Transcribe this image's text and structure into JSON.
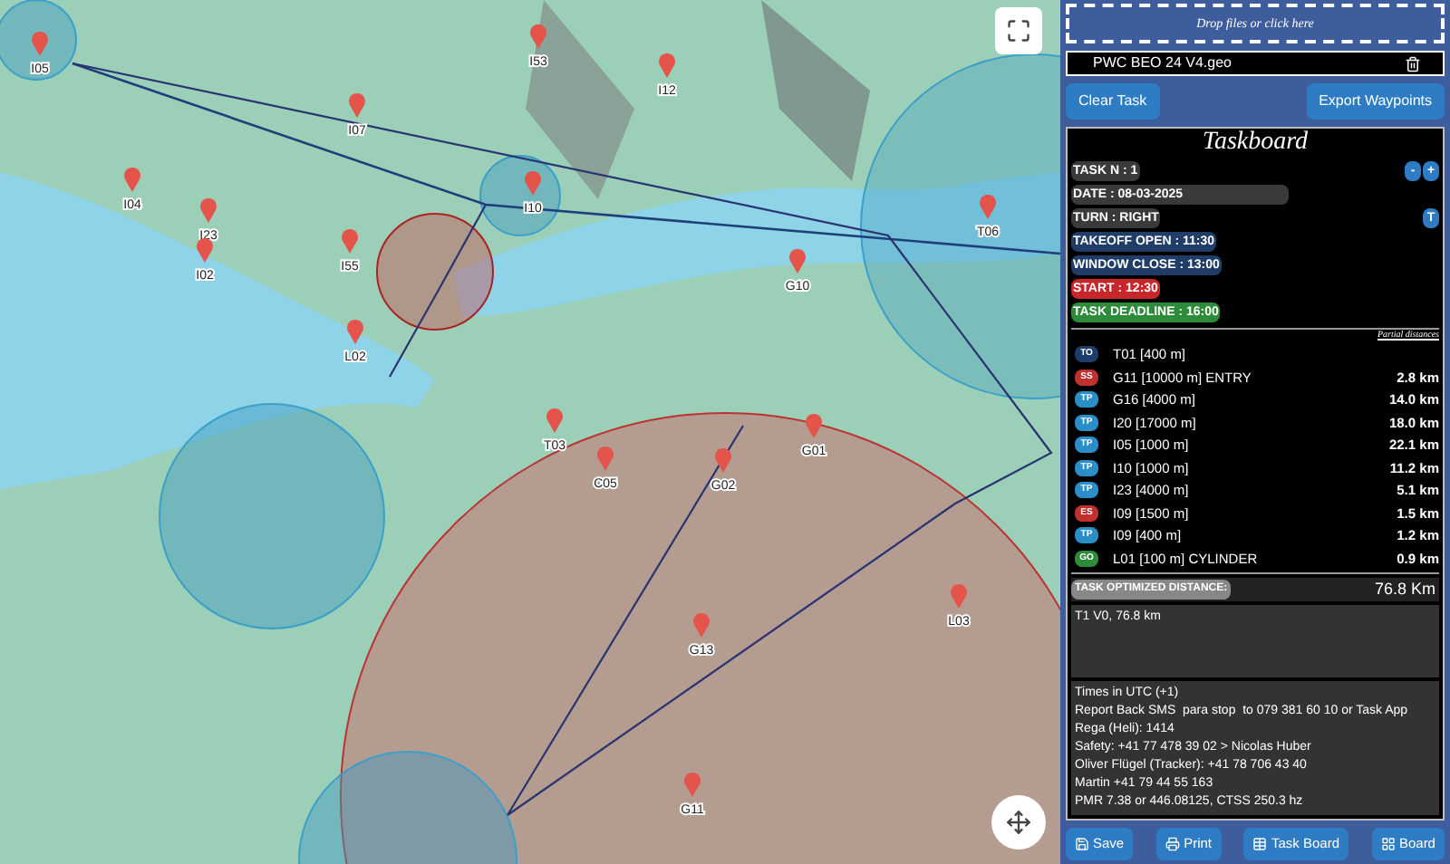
{
  "map": {
    "waypoints": [
      {
        "label": "I53"
      },
      {
        "label": "I05"
      },
      {
        "label": "I12"
      },
      {
        "label": "I07"
      },
      {
        "label": "I04"
      },
      {
        "label": "I10"
      },
      {
        "label": "T06"
      },
      {
        "label": "I23"
      },
      {
        "label": "I55"
      },
      {
        "label": "I02"
      },
      {
        "label": "G10"
      },
      {
        "label": "L02"
      },
      {
        "label": "T03"
      },
      {
        "label": "G01"
      },
      {
        "label": "C05"
      },
      {
        "label": "G02"
      },
      {
        "label": "L03"
      },
      {
        "label": "G13"
      },
      {
        "label": "G11"
      }
    ]
  },
  "upload": {
    "label": "Drop files or click here"
  },
  "file": {
    "name": "PWC BEO 24 V4.geo"
  },
  "actions": [
    "Clear Task",
    "Export Waypoints"
  ],
  "taskboard": {
    "title": "Taskboard",
    "info": [
      {
        "text": "TASK N : 1",
        "kind": "plain",
        "controls": [
          "-",
          "+"
        ]
      },
      {
        "text": "DATE : 08-03-2025",
        "kind": "wide"
      },
      {
        "text": "TURN : RIGHT",
        "kind": "plain",
        "controls": [
          "T"
        ]
      },
      {
        "text": "TAKEOFF OPEN : 11:30",
        "kind": "blue"
      },
      {
        "text": "WINDOW CLOSE : 13:00",
        "kind": "blue"
      },
      {
        "text": "START : 12:30",
        "kind": "red"
      },
      {
        "text": "TASK DEADLINE : 16:00",
        "kind": "green"
      }
    ],
    "partial_heading": "Partial distances",
    "turnpoints": [
      {
        "badge": "TO",
        "kind": "takeoff",
        "name": "T01 [400 m]"
      },
      {
        "badge": "SS",
        "kind": "start",
        "name": "G11 [10000 m] ENTRY",
        "distance": "2.8 km"
      },
      {
        "badge": "TP",
        "kind": "turnpoint",
        "name": "G16 [4000 m]",
        "distance": "14.0 km"
      },
      {
        "badge": "TP",
        "kind": "turnpoint",
        "name": "I20 [17000 m]",
        "distance": "18.0 km"
      },
      {
        "badge": "TP",
        "kind": "turnpoint",
        "name": "I05 [1000 m]",
        "distance": "22.1 km"
      },
      {
        "badge": "TP",
        "kind": "turnpoint",
        "name": "I10 [1000 m]",
        "distance": "11.2 km"
      },
      {
        "badge": "TP",
        "kind": "turnpoint",
        "name": "I23 [4000 m]",
        "distance": "5.1 km"
      },
      {
        "badge": "ES",
        "kind": "end",
        "name": "I09 [1500 m]",
        "distance": "1.5 km"
      },
      {
        "badge": "TP",
        "kind": "turnpoint",
        "name": "I09 [400 m]",
        "distance": "1.2 km"
      },
      {
        "badge": "GO",
        "kind": "goal",
        "name": "L01 [100 m] CYLINDER",
        "distance": "0.9 km"
      }
    ],
    "optimized": {
      "label": "TASK OPTIMIZED DISTANCE:",
      "value": "76.8 Km"
    },
    "summary": "T1 V0, 76.8 km",
    "notes": [
      "Times in UTC (+1)",
      "Report Back SMS  para stop  to 079 381 60 10 or Task App",
      "Rega (Heli): 1414",
      "Safety: +41 77 478 39 02 > Nicolas Huber",
      "Oliver Flügel (Tracker): +41 78 706 43 40",
      "Martin +41 79 44 55 163",
      "PMR 7.38 or 446.08125, CTSS 250.3 hz"
    ]
  },
  "footer": [
    {
      "label": "Save",
      "kind": "save"
    },
    {
      "label": "Print",
      "kind": "print"
    },
    {
      "label": "Task Board",
      "kind": "table"
    },
    {
      "label": "Board",
      "kind": "grid"
    }
  ]
}
